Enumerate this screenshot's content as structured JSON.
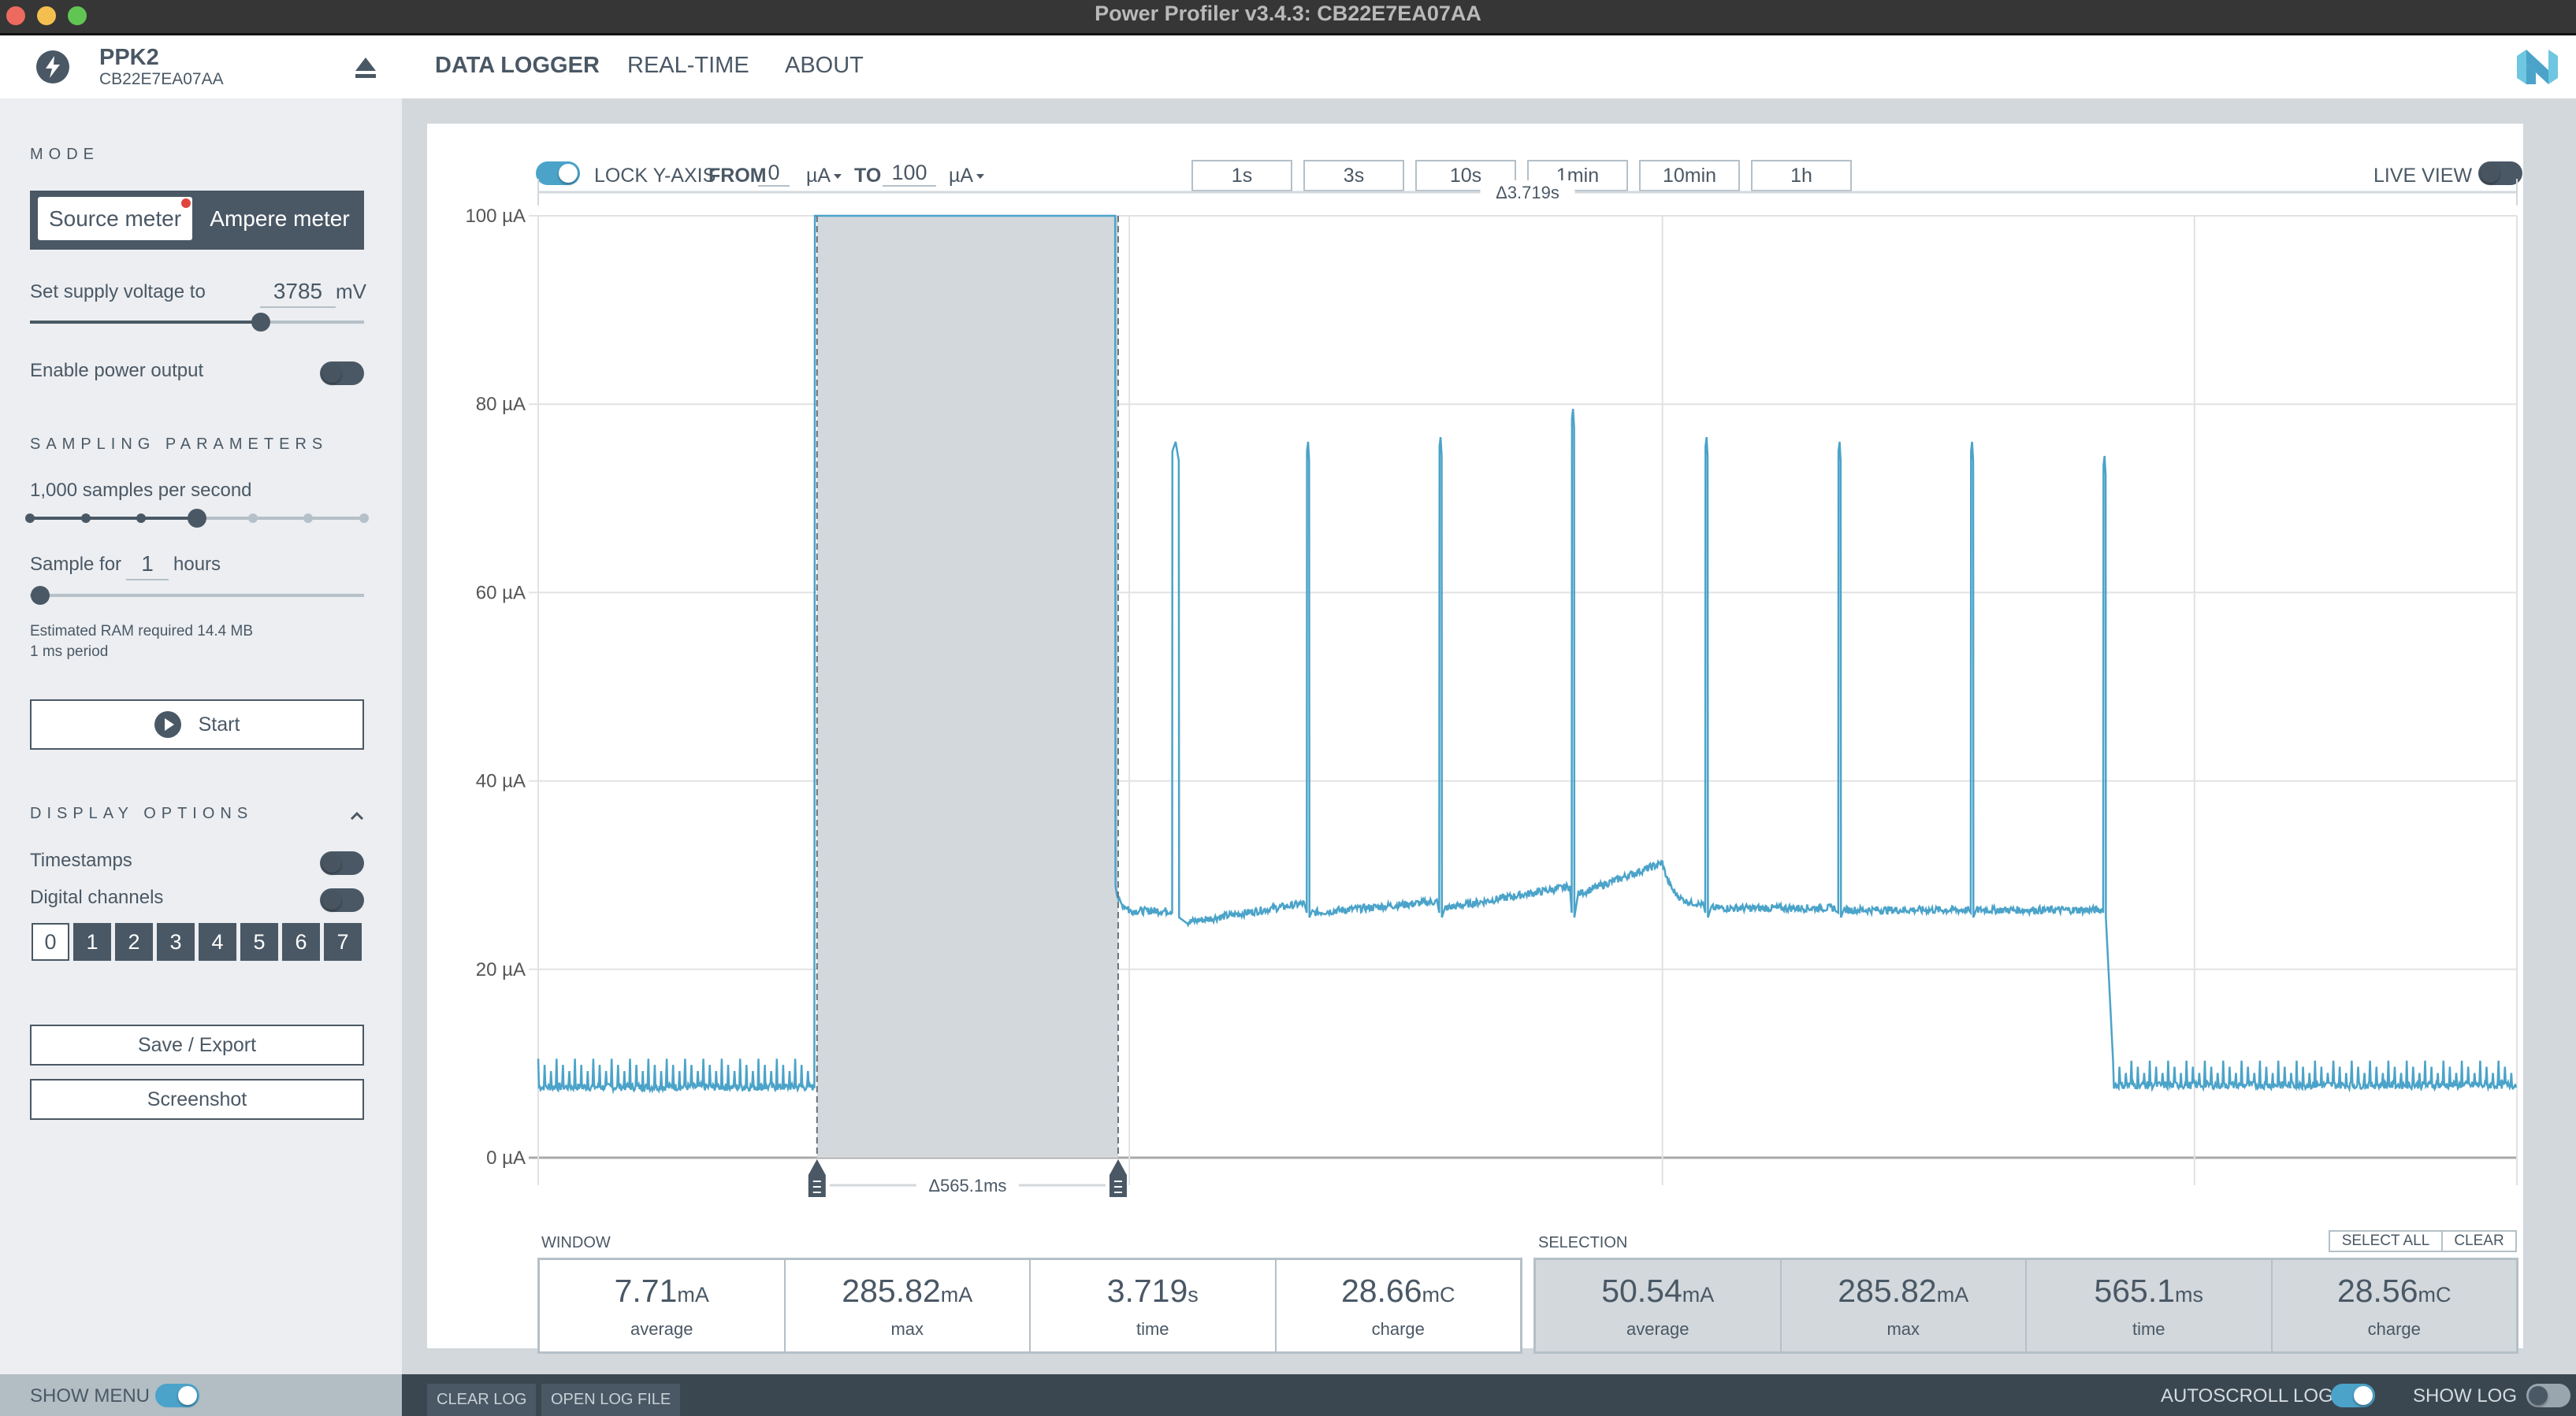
{
  "window": {
    "title": "Power Profiler v3.4.3: CB22E7EA07AA"
  },
  "header": {
    "device_name": "PPK2",
    "device_serial": "CB22E7EA07AA",
    "nav": [
      {
        "label": "DATA LOGGER",
        "active": true
      },
      {
        "label": "REAL-TIME",
        "active": false
      },
      {
        "label": "ABOUT",
        "active": false
      }
    ]
  },
  "sidebar": {
    "mode_label": "MODE",
    "mode_options": [
      "Source meter",
      "Ampere meter"
    ],
    "mode_selected": "Source meter",
    "supply_voltage_label": "Set supply voltage to",
    "supply_voltage_value": "3785",
    "supply_voltage_unit": "mV",
    "supply_voltage_fraction": 0.69,
    "enable_power_label": "Enable power output",
    "enable_power_on": false,
    "sampling_label": "SAMPLING PARAMETERS",
    "sample_rate_label": "1,000 samples per second",
    "sample_rate_step": 3,
    "sample_rate_steps": 6,
    "sample_for_label": "Sample for",
    "sample_for_value": "1",
    "sample_for_unit": "hours",
    "sample_for_fraction": 0.03,
    "ram_note": "Estimated RAM required 14.4 MB",
    "period_note": "1 ms period",
    "start_label": "Start",
    "display_options_label": "DISPLAY OPTIONS",
    "timestamps_label": "Timestamps",
    "timestamps_on": false,
    "digital_channels_label": "Digital channels",
    "digital_channels_on": false,
    "channels": [
      "0",
      "1",
      "2",
      "3",
      "4",
      "5",
      "6",
      "7"
    ],
    "save_export_label": "Save / Export",
    "screenshot_label": "Screenshot"
  },
  "toolbar": {
    "lock_yaxis_on": true,
    "lock_label": "LOCK Y-AXIS",
    "from_label": "FROM",
    "from_value": "0",
    "from_unit": "µA",
    "to_label": "TO",
    "to_value": "100",
    "to_unit": "µA",
    "time_buttons": [
      "1s",
      "3s",
      "10s",
      "1min",
      "10min",
      "1h"
    ],
    "live_view_label": "LIVE VIEW",
    "live_view_on": false
  },
  "chart_data": {
    "type": "line",
    "title": "",
    "xlabel": "",
    "ylabel": "",
    "y_unit": "µA",
    "ylim": [
      0,
      100
    ],
    "yticks": [
      0,
      20,
      40,
      60,
      80,
      100
    ],
    "ytick_labels": [
      "0 µA",
      "20 µA",
      "40 µA",
      "60 µA",
      "80 µA",
      "100 µA"
    ],
    "xlim_s": [
      0,
      3.719
    ],
    "x_grid_s": [
      0,
      1.111,
      2.113,
      3.113
    ],
    "grid": true,
    "window_delta_label": "Δ3.719s",
    "selection": {
      "start_s": 0.524,
      "end_s": 1.09,
      "delta_label": "Δ565.1ms"
    },
    "series": [
      {
        "name": "current",
        "color": "#4ba3c9",
        "segments": [
          {
            "t0": 0.0,
            "t1": 0.52,
            "kind": "ripple",
            "base": 7.5,
            "peak": 10.5,
            "period_s": 0.0115
          },
          {
            "t0": 0.52,
            "t1": 0.528,
            "kind": "level",
            "value": 100
          },
          {
            "t0": 0.528,
            "t1": 1.085,
            "kind": "level",
            "value": 100
          },
          {
            "t0": 1.085,
            "t1": 1.11,
            "kind": "decay",
            "from": 29,
            "to": 26.5
          },
          {
            "t0": 1.11,
            "t1": 1.19,
            "kind": "level",
            "value": 26.2
          },
          {
            "t0": 1.22,
            "t1": 1.44,
            "kind": "ramp",
            "from": 25,
            "to": 27
          },
          {
            "t0": 1.455,
            "t1": 1.69,
            "kind": "ramp",
            "from": 26,
            "to": 27.2
          },
          {
            "t0": 1.705,
            "t1": 1.94,
            "kind": "ramp",
            "from": 26.5,
            "to": 28.8
          },
          {
            "t0": 1.955,
            "t1": 2.113,
            "kind": "ramp",
            "from": 28,
            "to": 31.3
          },
          {
            "t0": 2.113,
            "t1": 2.19,
            "kind": "decay",
            "from": 31.3,
            "to": 26.8
          },
          {
            "t0": 2.205,
            "t1": 2.44,
            "kind": "level",
            "value": 26.5
          },
          {
            "t0": 2.455,
            "t1": 2.69,
            "kind": "level",
            "value": 26.3
          },
          {
            "t0": 2.705,
            "t1": 2.94,
            "kind": "level",
            "value": 26.3
          },
          {
            "t0": 2.96,
            "t1": 3.719,
            "kind": "ripple",
            "base": 7.7,
            "peak": 10.3,
            "period_s": 0.0115
          }
        ],
        "spikes": [
          {
            "t": 1.198,
            "value": 76.0,
            "width_s": 0.012
          },
          {
            "t": 1.447,
            "value": 76.0,
            "width_s": 0.004
          },
          {
            "t": 1.696,
            "value": 76.5,
            "width_s": 0.004
          },
          {
            "t": 1.945,
            "value": 79.5,
            "width_s": 0.004
          },
          {
            "t": 2.196,
            "value": 76.5,
            "width_s": 0.004
          },
          {
            "t": 2.446,
            "value": 76.0,
            "width_s": 0.004
          },
          {
            "t": 2.695,
            "value": 76.0,
            "width_s": 0.004
          },
          {
            "t": 2.944,
            "value": 74.5,
            "width_s": 0.004
          }
        ]
      }
    ]
  },
  "stats": {
    "window_label": "WINDOW",
    "window": [
      {
        "value": "7.71",
        "unit": "mA",
        "caption": "average"
      },
      {
        "value": "285.82",
        "unit": "mA",
        "caption": "max"
      },
      {
        "value": "3.719",
        "unit": "s",
        "caption": "time"
      },
      {
        "value": "28.66",
        "unit": "mC",
        "caption": "charge"
      }
    ],
    "selection_label": "SELECTION",
    "select_all_label": "SELECT ALL",
    "clear_label": "CLEAR",
    "selection": [
      {
        "value": "50.54",
        "unit": "mA",
        "caption": "average"
      },
      {
        "value": "285.82",
        "unit": "mA",
        "caption": "max"
      },
      {
        "value": "565.1",
        "unit": "ms",
        "caption": "time"
      },
      {
        "value": "28.56",
        "unit": "mC",
        "caption": "charge"
      }
    ]
  },
  "bottom": {
    "show_menu_label": "SHOW MENU",
    "show_menu_on": true,
    "clear_log_label": "CLEAR LOG",
    "open_log_file_label": "OPEN LOG FILE",
    "autoscroll_label": "AUTOSCROLL LOG",
    "autoscroll_on": true,
    "show_log_label": "SHOW LOG",
    "show_log_on": false
  },
  "colors": {
    "accent": "#4ba3c9",
    "primary": "#4a5865",
    "selection_fill": "#d2d8dc",
    "status_dot": "#e0443c"
  }
}
